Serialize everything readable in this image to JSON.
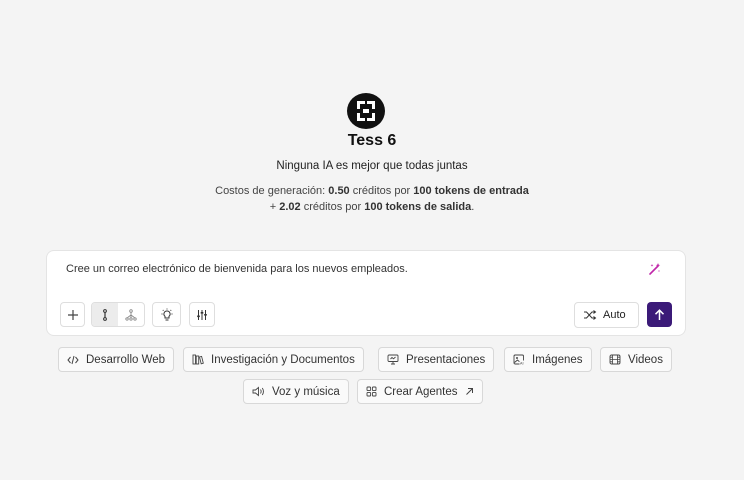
{
  "header": {
    "title": "Tess 6",
    "tagline": "Ninguna IA es mejor que todas juntas",
    "costs": {
      "prefix": "Costos de generación:",
      "input_value": "0.50",
      "input_mid": "créditos por",
      "input_tokens": "100 tokens de entrada",
      "output_prefix": "+",
      "output_value": "2.02",
      "output_mid": "créditos por",
      "output_tokens": "100 tokens de salida",
      "output_suffix": "."
    }
  },
  "composer": {
    "prompt_text": "Cree un correo electrónico de bienvenida para los nuevos empleados.",
    "model_selector_label": "Auto",
    "accent_color": "#3b1a78",
    "magic_color": "#c026a8"
  },
  "categories": [
    {
      "label": "Desarrollo Web",
      "icon": "code-icon"
    },
    {
      "label": "Investigación y Documentos",
      "icon": "books-icon"
    },
    {
      "label": "Presentaciones",
      "icon": "presentation-icon"
    },
    {
      "label": "Imágenes",
      "icon": "image-ai-icon"
    },
    {
      "label": "Videos",
      "icon": "film-icon"
    },
    {
      "label": "Voz y música",
      "icon": "speaker-icon"
    },
    {
      "label": "Crear Agentes",
      "icon": "grid-icon",
      "trailing_icon": "arrow-up-right-icon"
    }
  ]
}
